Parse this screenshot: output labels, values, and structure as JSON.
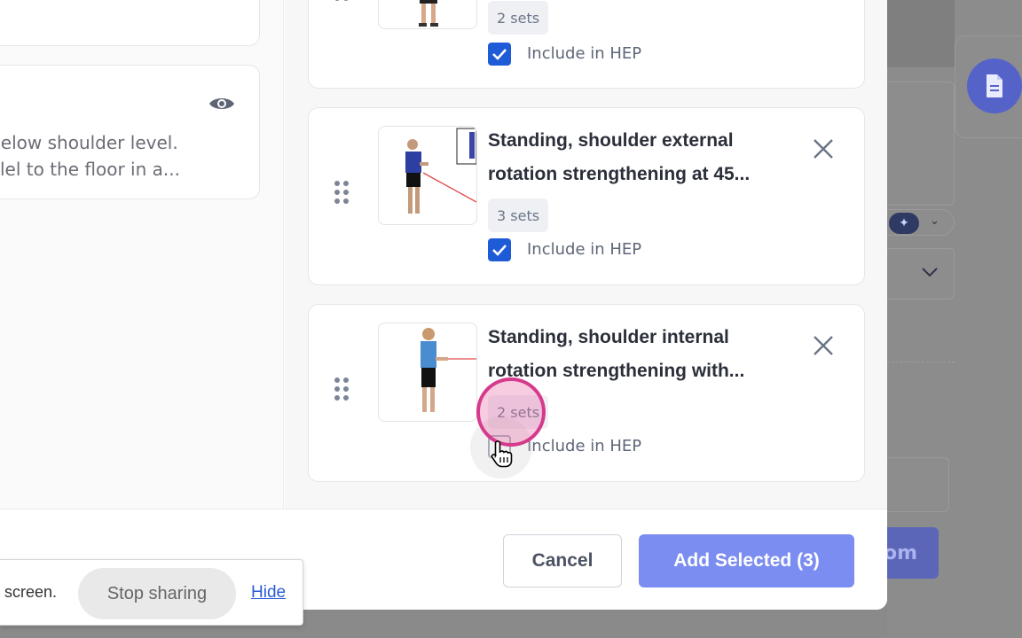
{
  "left_pane": {
    "description_line1": "ont below shoulder level.",
    "description_line2": "parallel to the floor in a..."
  },
  "exercises": [
    {
      "title_line1": "",
      "title_line2": "",
      "sets": "2 sets",
      "include_label": "Include in HEP",
      "included": true
    },
    {
      "title_line1": "Standing, shoulder external",
      "title_line2": "rotation strengthening at 45...",
      "sets": "3 sets",
      "include_label": "Include in HEP",
      "included": true
    },
    {
      "title_line1": "Standing, shoulder internal",
      "title_line2": "rotation strengthening with...",
      "sets": "2 sets",
      "include_label": "Include in HEP",
      "included": false
    }
  ],
  "footer": {
    "cancel_label": "Cancel",
    "add_label": "Add Selected (3)"
  },
  "share_bar": {
    "text": "screen.",
    "stop_label": "Stop sharing",
    "hide_label": "Hide"
  },
  "background": {
    "button_text": "om"
  },
  "colors": {
    "primary": "#7b8df0",
    "checkbox": "#1e5bd6",
    "click_highlight": "#d63a8d"
  }
}
